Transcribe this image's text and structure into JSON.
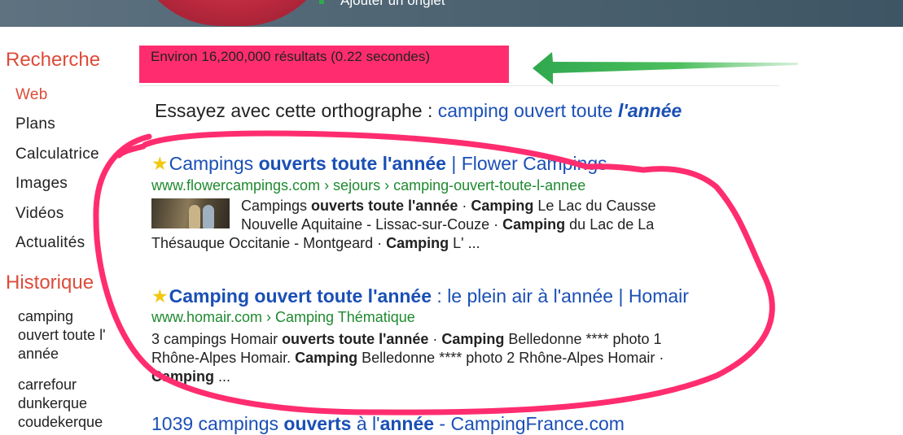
{
  "header": {
    "tab_label": "Ajouter un onglet"
  },
  "sidebar": {
    "title": "Recherche",
    "items": [
      {
        "label": "Web",
        "active": true
      },
      {
        "label": "Plans"
      },
      {
        "label": "Calculatrice"
      },
      {
        "label": "Images"
      },
      {
        "label": "Vidéos"
      },
      {
        "label": "Actualités"
      }
    ],
    "history_title": "Historique",
    "history": [
      {
        "lines": [
          "camping",
          "ouvert toute l'",
          "année"
        ]
      },
      {
        "lines": [
          "carrefour",
          "dunkerque",
          "coudekerque"
        ]
      }
    ]
  },
  "stats": {
    "text": "Environ 16,200,000 résultats (0.22 secondes)"
  },
  "suggestion": {
    "prefix": "Essayez avec cette orthographe : ",
    "link_plain": "camping ouvert toute ",
    "link_emph": "l'année"
  },
  "results": [
    {
      "title_plain_1": "Campings ",
      "title_bold": "ouverts toute l'année",
      "title_plain_2": " | Flower Campings",
      "url": "www.flowercampings.com › sejours › camping-ouvert-toute-l-annee",
      "snippet": [
        [
          "Campings ",
          "ouverts toute l'année",
          " · ",
          "Camping",
          " Le Lac du Causse"
        ],
        [
          "Nouvelle Aquitaine - Lissac-sur-Couze · ",
          "Camping",
          " du Lac de La"
        ],
        [
          "Thésauque Occitanie - Montgeard · ",
          "Camping",
          " L' ..."
        ]
      ]
    },
    {
      "title_bold": "Camping ouvert toute l'année",
      "title_plain_2": " : le plein air à l'année | Homair",
      "url": "www.homair.com › Camping Thématique",
      "snippet": [
        [
          "3 campings Homair ",
          "ouverts toute l'année",
          " · ",
          "Camping",
          " Belledonne **** photo 1"
        ],
        [
          "Rhône-Alpes Homair. ",
          "Camping",
          " Belledonne **** photo 2 Rhône-Alpes Homair ·"
        ],
        [
          "",
          "Camping",
          " ..."
        ]
      ]
    },
    {
      "title_plain_1": "1039 campings ",
      "title_bold": "ouverts",
      "title_plain_2": " à l'",
      "title_bold_2": "année",
      "title_plain_3": " - CampingFrance.com"
    }
  ],
  "colors": {
    "accent": "#dd4b39",
    "link": "#1a4fb5",
    "url": "#1e8a2f",
    "highlight": "#ff2d6f",
    "annotation_arrow": "#2fa84f",
    "annotation_circle": "#ff2d6f"
  },
  "icons": {
    "star": "star-icon",
    "arrow": "green-arrow-annotation"
  }
}
